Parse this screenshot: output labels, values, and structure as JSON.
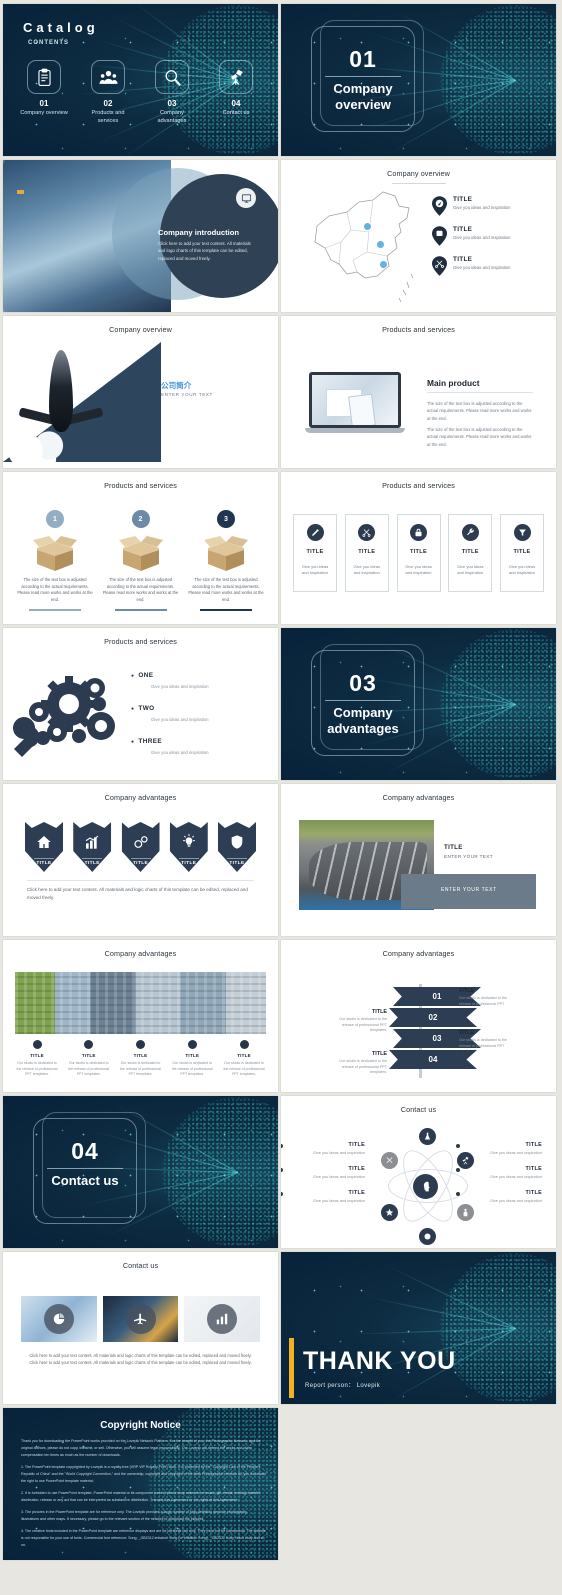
{
  "theme": {
    "navy": "#2c3d54",
    "dark_bg": "#0d2b41",
    "teal": "#4fd6d0",
    "accent_blue": "#3f93d8",
    "yellow": "#f2b223"
  },
  "slide1": {
    "title": "Catalog",
    "subtitle": "CONTENTS",
    "items": [
      {
        "num": "01",
        "label": "Company overview",
        "icon": "clipboard-icon"
      },
      {
        "num": "02",
        "label": "Products and services",
        "icon": "people-icon"
      },
      {
        "num": "03",
        "label": "Company advantages",
        "icon": "magnifier-icon"
      },
      {
        "num": "04",
        "label": "Contact us",
        "icon": "telescope-icon"
      }
    ]
  },
  "slide2": {
    "num": "01",
    "text": "Company overview"
  },
  "slide3": {
    "heading": "Company introduction",
    "body": "Click here to add your text content. All materials and logo charts of this template can be edited, replaced and moved freely.",
    "icon": "monitor-icon"
  },
  "slide4": {
    "title": "Company overview",
    "pins": [
      {
        "icon": "compass-icon",
        "title": "TITLE",
        "desc": "Give you ideas and inspiration"
      },
      {
        "icon": "window-icon",
        "title": "TITLE",
        "desc": "Give you ideas and inspiration"
      },
      {
        "icon": "scissors-icon",
        "title": "TITLE",
        "desc": "Give you ideas and inspiration"
      }
    ]
  },
  "slide5": {
    "title": "Company overview",
    "cn": "公司简介",
    "en": "ENTER YOUR TEXT"
  },
  "slide6": {
    "title": "Products and services",
    "heading": "Main product",
    "p1": "The size of the text box is adjusted according to the actual requirements. Please read more works and works at the end.",
    "p2": "The size of the text box is adjusted according to the actual requirements. Please read more works and works at the end."
  },
  "slide7": {
    "title": "Products and services",
    "columns": [
      {
        "num": "1",
        "color": "#93aec4",
        "text": "The size of the text box is adjusted according to the actual requirements. Please read more works and works at the end."
      },
      {
        "num": "2",
        "color": "#6d8ba6",
        "text": "The size of the text box is adjusted according to the actual requirements. Please read more works and works at the end."
      },
      {
        "num": "3",
        "color": "#20364f",
        "text": "The size of the text box is adjusted according to the actual requirements. Please read more works and works at the end."
      }
    ]
  },
  "slide8": {
    "title": "Products and services",
    "cards": [
      {
        "icon": "pen-icon",
        "title": "TITLE",
        "desc": "Give you ideas and inspiration"
      },
      {
        "icon": "scissors-icon",
        "title": "TITLE",
        "desc": "Give you ideas and inspiration"
      },
      {
        "icon": "lock-icon",
        "title": "TITLE",
        "desc": "Give you ideas and inspiration"
      },
      {
        "icon": "wrench-icon",
        "title": "TITLE",
        "desc": "Give you ideas and inspiration"
      },
      {
        "icon": "funnel-icon",
        "title": "TITLE",
        "desc": "Give you ideas and inspiration"
      }
    ]
  },
  "slide9": {
    "title": "Products and services",
    "items": [
      {
        "title": "ONE",
        "desc": "Give you ideas and inspiration"
      },
      {
        "title": "TWO",
        "desc": "Give you ideas and inspiration"
      },
      {
        "title": "THREE",
        "desc": "Give you ideas and inspiration"
      }
    ]
  },
  "slide10": {
    "num": "03",
    "text": "Company advantages"
  },
  "slide11": {
    "title": "Company advantages",
    "shields": [
      {
        "icon": "home-icon",
        "label": "TITLE"
      },
      {
        "icon": "bar-chart-icon",
        "label": "TITLE"
      },
      {
        "icon": "gears-icon",
        "label": "TITLE"
      },
      {
        "icon": "lightbulb-icon",
        "label": "TITLE"
      },
      {
        "icon": "shield-check-icon",
        "label": "TITLE"
      }
    ],
    "note": "Click here to add your text content. All materials and logic charts of this template can be edited, replaced and moved freely."
  },
  "slide12": {
    "title": "Company advantages",
    "item_title": "TITLE",
    "item_sub": "ENTER YOUR TEXT",
    "band_text": "ENTER YOUR TEXT"
  },
  "slide13": {
    "title": "Company advantages",
    "columns": [
      {
        "title": "TITLE",
        "desc": "Our studio is dedicated to the release of professional PPT templates."
      },
      {
        "title": "TITLE",
        "desc": "Our studio is dedicated to the release of professional PPT templates."
      },
      {
        "title": "TITLE",
        "desc": "Our studio is dedicated to the release of professional PPT templates."
      },
      {
        "title": "TITLE",
        "desc": "Our studio is dedicated to the release of professional PPT templates."
      },
      {
        "title": "TITLE",
        "desc": "Our studio is dedicated to the release of professional PPT templates."
      }
    ]
  },
  "slide14": {
    "title": "Company advantages",
    "ribbons": [
      {
        "num": "01",
        "title": "TITLE",
        "desc": "Our studio is dedicated to the release of professional PPT templates.",
        "side": "right"
      },
      {
        "num": "02",
        "title": "TITLE",
        "desc": "Our studio is dedicated to the release of professional PPT templates.",
        "side": "left"
      },
      {
        "num": "03",
        "title": "TITLE",
        "desc": "Our studio is dedicated to the release of professional PPT templates.",
        "side": "right"
      },
      {
        "num": "04",
        "title": "TITLE",
        "desc": "Our studio is dedicated to the release of professional PPT templates.",
        "side": "left"
      }
    ]
  },
  "slide15": {
    "num": "04",
    "text": "Contact us"
  },
  "slide16": {
    "title": "Contact us",
    "left": [
      {
        "title": "TITLE",
        "desc": "Give you ideas and inspiration"
      },
      {
        "title": "TITLE",
        "desc": "Give you ideas and inspiration"
      },
      {
        "title": "TITLE",
        "desc": "Give you ideas and inspiration"
      }
    ],
    "right": [
      {
        "title": "TITLE",
        "desc": "Give you ideas and inspiration"
      },
      {
        "title": "TITLE",
        "desc": "Give you ideas and inspiration"
      },
      {
        "title": "TITLE",
        "desc": "Give you ideas and inspiration"
      }
    ],
    "nodes": [
      "flask-icon",
      "telescope-icon",
      "person-icon",
      "star-icon",
      "scissors-icon",
      "head-icon"
    ]
  },
  "slide17": {
    "title": "Contact us",
    "photos": [
      {
        "icon": "pie-chart-icon"
      },
      {
        "icon": "plane-icon"
      },
      {
        "icon": "bar-chart-icon"
      }
    ],
    "note": "Click here to add your text content. All materials and logic charts of this template can be edited, replaced and moved freely. Click here to add your text content. All materials and logic charts of this template can be edited, replaced and moved freely."
  },
  "slide18": {
    "heading": "THANK YOU",
    "sub": "Report person： Lovepik"
  },
  "slide19": {
    "heading": "Copyright Notice",
    "intro": "Thank you for downloading the PowerPoint works provided on the Lovepik Network Platform. For the benefit of you, the Photographic Network, and the original authors, please do not copy, transmit, or sell. Otherwise, you will assume legal responsibility. The Lovepik will defend the works and claim compensation ten times as much as the number of downloads.",
    "p1": "1. The PowerPoint template copyrighted by Lovepik is a royalty-free (VRP VIP Royalty-Free) work. It is protected by the \"Copyright Law of the People's Republic of China\" and the \"World Copyright Convention,\" and the ownership, copyright and copyright of the work Photographic network all, you download the right to use PowerPoint template material;",
    "p2": "2. It is forbidden to use PowerPoint template, PowerPoint material or its component parts of photo shop network for resale, gift, rental, lending, transfer, distribution, release or any act that can be interpreted as substantive distribution. Transfer this Agreement or the rights in this Agreement;",
    "p3": "3. The pictures in the PowerPoint template are for reference only. The Lovepik provides a large number of high-definition genuine photography, illustrations and other maps. If necessary, please go to the relevant section of the network to download the pictures.",
    "p4": "4. The creative fonts included in the PowerPoint template are reference displays and are for personal use only. They must not be commercial. The website is not responsible for your use of fonts. Commercial font reference: Song, _GB2312 imitation Song (or imitation Song), _GB2312 body, black body and so on."
  }
}
